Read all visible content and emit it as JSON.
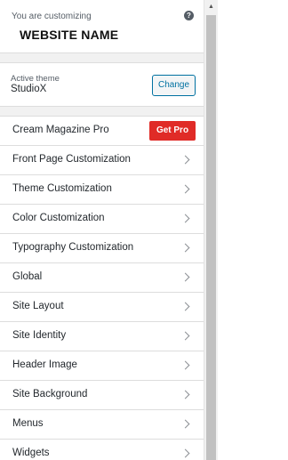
{
  "header": {
    "customizing_label": "You are customizing",
    "site_name": "WEBSITE NAME",
    "help_symbol": "?"
  },
  "theme": {
    "active_label": "Active theme",
    "name": "StudioX",
    "change_label": "Change"
  },
  "pro_item": {
    "label": "Cream Magazine Pro",
    "button_label": "Get Pro",
    "button_color": "#e02b27"
  },
  "menu": {
    "items": [
      {
        "label": "Front Page Customization"
      },
      {
        "label": "Theme Customization"
      },
      {
        "label": "Color Customization"
      },
      {
        "label": "Typography Customization"
      },
      {
        "label": "Global"
      },
      {
        "label": "Site Layout"
      },
      {
        "label": "Site Identity"
      },
      {
        "label": "Header Image"
      },
      {
        "label": "Site Background"
      },
      {
        "label": "Menus"
      },
      {
        "label": "Widgets"
      }
    ]
  },
  "scrollbar": {
    "up_arrow": "▲"
  },
  "colors": {
    "accent": "#0071a1",
    "panel_bg": "#f1f1f1"
  }
}
